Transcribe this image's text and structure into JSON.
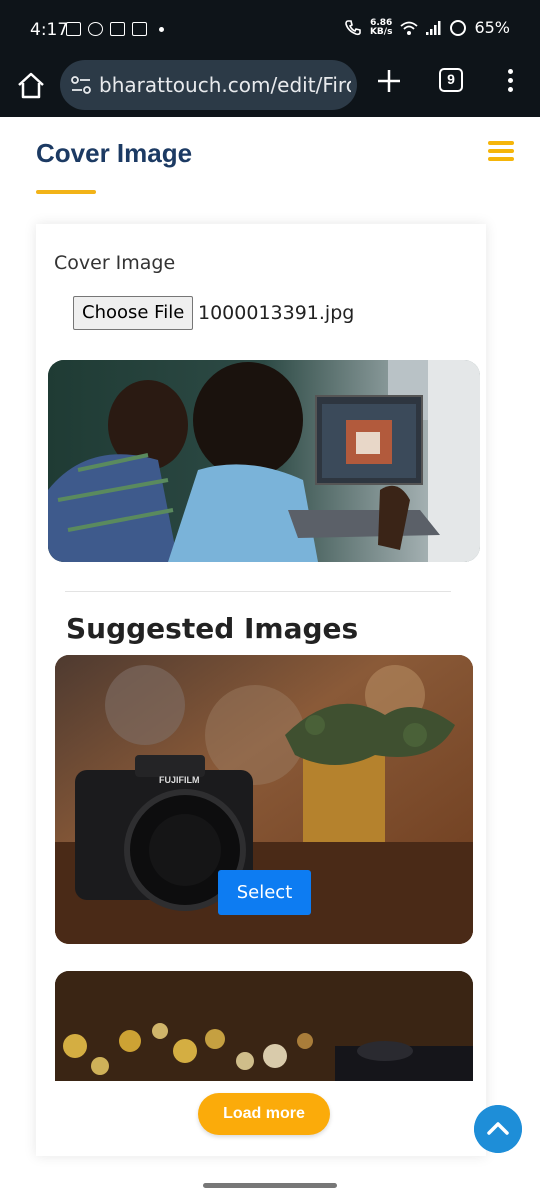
{
  "status_bar": {
    "time": "4:17",
    "net_speed_value": "6.86",
    "net_speed_unit": "KB/s",
    "battery": "65%"
  },
  "browser": {
    "url": "bharattouch.com/edit/Firoz.",
    "tab_count": "9"
  },
  "page": {
    "title": "Cover Image",
    "accent_color": "#f2b318",
    "title_color": "#1c3a63"
  },
  "form": {
    "field_label": "Cover Image",
    "choose_file_label": "Choose File",
    "file_name": "1000013391.jpg"
  },
  "suggested": {
    "heading": "Suggested Images",
    "select_label": "Select",
    "camera_brand_text": "FUJIFILM",
    "load_more_label": "Load more"
  },
  "icons": {
    "home": "home-icon",
    "site_settings": "site-settings-icon",
    "new_tab": "plus-icon",
    "tabs": "tab-switcher-icon",
    "more": "more-vert-icon",
    "hamburger": "hamburger-menu-icon",
    "scroll_top": "chevron-up-icon"
  }
}
